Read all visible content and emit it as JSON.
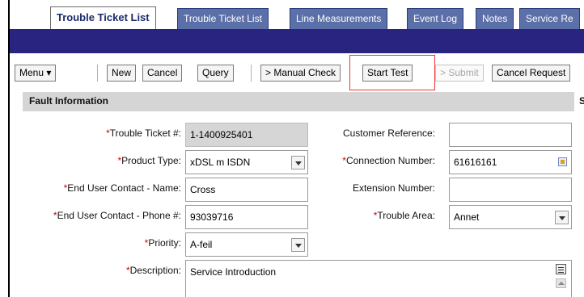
{
  "tabs": [
    {
      "label": "Trouble Ticket List",
      "active": true
    },
    {
      "label": "Trouble Ticket List",
      "active": false
    },
    {
      "label": "Line Measurements",
      "active": false
    },
    {
      "label": "Event Log",
      "active": false
    },
    {
      "label": "Notes",
      "active": false
    },
    {
      "label": "Service Re",
      "active": false
    }
  ],
  "toolbar": {
    "menu": "Menu ▾",
    "new": "New",
    "cancel": "Cancel",
    "query": "Query",
    "manual_check": "> Manual Check",
    "start_test": "Start Test",
    "submit": "> Submit",
    "cancel_request": "Cancel Request"
  },
  "section": {
    "title": "Fault Information",
    "side_letter": "S"
  },
  "form": {
    "trouble_ticket": {
      "label": "Trouble Ticket #:",
      "value": "1-1400925401"
    },
    "product_type": {
      "label": "Product Type:",
      "value": "xDSL m ISDN"
    },
    "end_user_name": {
      "label": "End User Contact - Name:",
      "value": "Cross"
    },
    "end_user_phone": {
      "label": "End User Contact - Phone #:",
      "value": "93039716"
    },
    "priority": {
      "label": "Priority:",
      "value": "A-feil"
    },
    "description": {
      "label": "Description:",
      "value": "Service Introduction"
    },
    "customer_reference": {
      "label": "Customer Reference:",
      "value": ""
    },
    "connection_number": {
      "label": "Connection Number:",
      "value": "61616161"
    },
    "extension_number": {
      "label": "Extension Number:",
      "value": ""
    },
    "trouble_area": {
      "label": "Trouble Area:",
      "value": "Annet"
    }
  },
  "required_marker": "*",
  "colors": {
    "tab_bg": "#5b6fa8",
    "banner": "#28247f",
    "required": "#cc0000",
    "highlight": "#ee3333",
    "section_bg": "#d5d5d5"
  }
}
